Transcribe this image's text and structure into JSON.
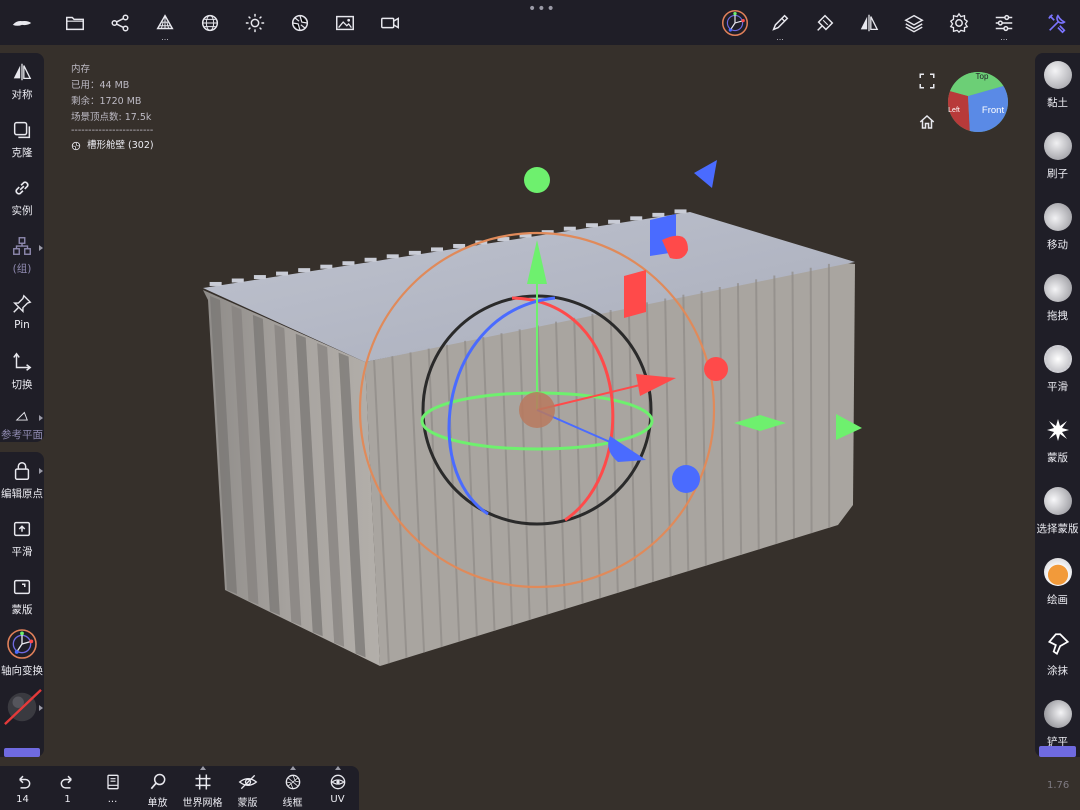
{
  "top_toolbar": {
    "left_icons": [
      "logo-icon",
      "folder-icon",
      "scene-graph-icon",
      "topology-icon",
      "wireframe-sphere-icon",
      "light-icon",
      "material-icon",
      "image-icon",
      "camera-icon"
    ],
    "right_icons": [
      "gizmo-icon",
      "brush-stroke-icon",
      "paint-brush-icon",
      "symmetry-icon",
      "layers-icon",
      "settings-icon",
      "sliders-icon",
      "tools-icon"
    ],
    "handle": "•••",
    "more": "..."
  },
  "info": {
    "title": "内存",
    "used": "已用：44 MB",
    "free": "剩余：1720 MB",
    "vertices": "场景顶点数: 17.5k",
    "divider": "------------------------",
    "object": "槽形舱壁 (302)"
  },
  "left_tools_top": [
    {
      "label": "对称",
      "icon": "symmetry-icon"
    },
    {
      "label": "克隆",
      "icon": "clone-icon"
    },
    {
      "label": "实例",
      "icon": "link-icon"
    },
    {
      "label": "(组)",
      "icon": "group-icon"
    },
    {
      "label": "Pin",
      "icon": "pin-icon"
    },
    {
      "label": "切换",
      "icon": "axes-icon"
    },
    {
      "label": "参考平面",
      "icon": "angle-icon"
    }
  ],
  "left_tools_bottom": [
    {
      "label": "编辑原点",
      "icon": "lock-icon"
    },
    {
      "label": "平滑",
      "icon": "smooth-box-icon"
    },
    {
      "label": "蒙版",
      "icon": "mask-box-icon"
    },
    {
      "label": "轴向变换",
      "icon": "gizmo-icon"
    }
  ],
  "right_tools": [
    {
      "label": "黏土",
      "color": "#cfcfd4"
    },
    {
      "label": "刷子",
      "color": "#cfcfd4"
    },
    {
      "label": "移动",
      "color": "#cfcfd4"
    },
    {
      "label": "拖拽",
      "color": "#cfcfd4"
    },
    {
      "label": "平滑",
      "color": "#e6e6ea"
    },
    {
      "label": "蒙版",
      "color": "#ffffff"
    },
    {
      "label": "选择蒙版",
      "color": "#d8d8dc"
    },
    {
      "label": "绘画",
      "color": "#f29a3a"
    },
    {
      "label": "涂抹",
      "color": "#ffffff"
    },
    {
      "label": "铲平",
      "color": "#dcdce0"
    }
  ],
  "bottom_toolbar": [
    {
      "label": "14",
      "icon": "undo-icon"
    },
    {
      "label": "1",
      "icon": "redo-icon"
    },
    {
      "label": "...",
      "icon": "book-icon"
    },
    {
      "label": "单放",
      "icon": "search-icon"
    },
    {
      "label": "世界网格",
      "icon": "grid-icon"
    },
    {
      "label": "蒙版",
      "icon": "eye-hidden-icon"
    },
    {
      "label": "线框",
      "icon": "wireframe-sphere-icon"
    },
    {
      "label": "UV",
      "icon": "eye-icon"
    }
  ],
  "nav_cube": {
    "top": "Top",
    "front": "Front",
    "left": "Left"
  },
  "version": "1.76",
  "colors": {
    "panel": "#1f1e27",
    "viewport": "#36302b",
    "accent": "#6f6ae0",
    "x_axis": "#ff4a4a",
    "y_axis": "#6ef06e",
    "z_axis": "#4a6bff"
  }
}
